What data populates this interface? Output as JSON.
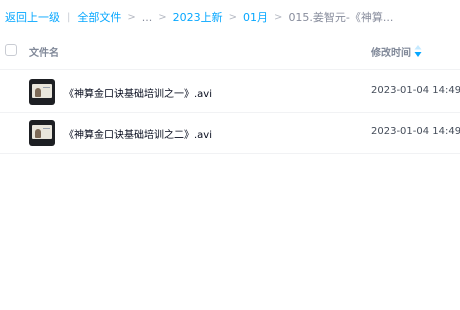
{
  "breadcrumb": {
    "back_label": "返回上一级",
    "all_files_label": "全部文件",
    "ellipsis": "...",
    "items": [
      "2023上新",
      "01月"
    ],
    "current": "015.姜智元-《神算..."
  },
  "table": {
    "columns": {
      "name": "文件名",
      "modified": "修改时间"
    },
    "sort": {
      "column": "modified",
      "icon": "sort-arrow-icon"
    },
    "rows": [
      {
        "name": "《神算金口诀基础培训之一》.avi",
        "modified": "2023-01-04 14:49",
        "icon": "video-thumbnail"
      },
      {
        "name": "《神算金口诀基础培训之二》.avi",
        "modified": "2023-01-04 14:49",
        "icon": "video-thumbnail"
      }
    ]
  },
  "colors": {
    "link": "#06a7ff",
    "muted": "#878c9c",
    "text": "#03081a",
    "header_text": "#818999"
  }
}
